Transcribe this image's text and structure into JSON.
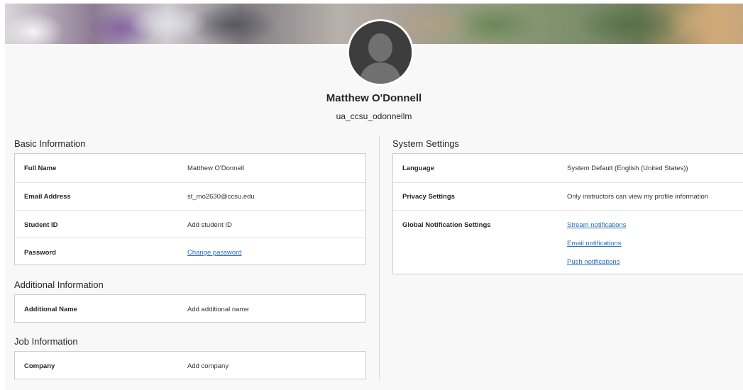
{
  "profile": {
    "name": "Matthew O'Donnell",
    "username": "ua_ccsu_odonnellm"
  },
  "basic_information": {
    "title": "Basic Information",
    "rows": [
      {
        "label": "Full Name",
        "value": "Matthew O'Donnell"
      },
      {
        "label": "Email Address",
        "value": "st_mo2630@ccsu.edu"
      },
      {
        "label": "Student ID",
        "value": "Add student ID"
      },
      {
        "label": "Password",
        "value": "Change password"
      }
    ]
  },
  "additional_information": {
    "title": "Additional Information",
    "rows": [
      {
        "label": "Additional Name",
        "value": "Add additional name"
      }
    ]
  },
  "job_information": {
    "title": "Job Information",
    "rows": [
      {
        "label": "Company",
        "value": "Add company"
      }
    ]
  },
  "system_settings": {
    "title": "System Settings",
    "rows": [
      {
        "label": "Language",
        "value": "System Default (English (United States))"
      },
      {
        "label": "Privacy Settings",
        "value": "Only instructors can view my profile information"
      },
      {
        "label": "Global Notification Settings",
        "links": [
          "Stream notifications",
          "Email notifications",
          "Push notifications"
        ]
      }
    ]
  },
  "colors": {
    "link": "#2a6fb5",
    "page_background": "#f8f8f8",
    "card_border": "#cdcdcd"
  },
  "icons": {
    "avatar": "default-person-silhouette-icon"
  }
}
